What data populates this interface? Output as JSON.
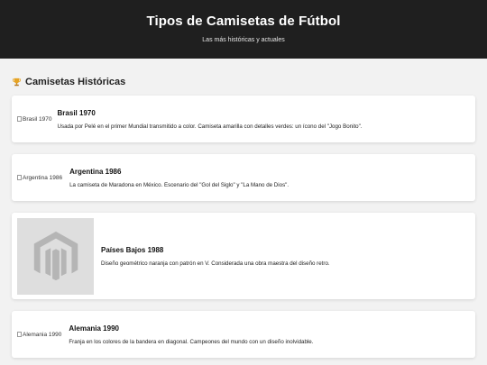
{
  "header": {
    "title": "Tipos de Camisetas de Fútbol",
    "subtitle": "Las más históricas y actuales"
  },
  "section": {
    "icon": "trophy-icon",
    "title": "Camisetas Históricas"
  },
  "cards": [
    {
      "alt": "Brasil 1970",
      "title": "Brasil 1970",
      "description": "Usada por Pelé en el primer Mundial transmitido a color. Camiseta amarilla con detalles verdes: un ícono del \"Jogo Bonito\"."
    },
    {
      "alt": "Argentina 1986",
      "title": "Argentina 1986",
      "description": "La camiseta de Maradona en México. Escenario del \"Gol del Siglo\" y \"La Mano de Dios\"."
    },
    {
      "alt": "",
      "image_icon": "magento-logo-icon",
      "title": "Países Bajos 1988",
      "description": "Diseño geométrico naranja con patrón en V. Considerada una obra maestra del diseño retro."
    },
    {
      "alt": "Alemania 1990",
      "title": "Alemania 1990",
      "description": "Franja en los colores de la bandera en diagonal. Campeones del mundo con un diseño inolvidable."
    }
  ]
}
